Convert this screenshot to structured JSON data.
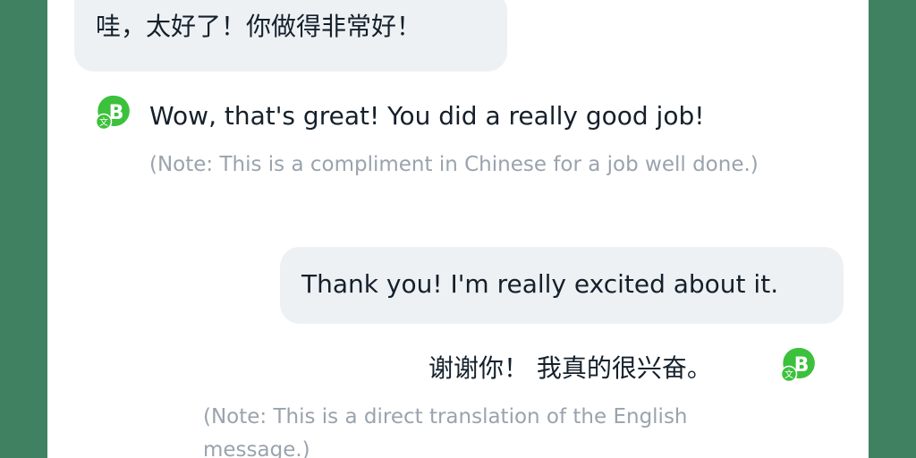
{
  "messages": [
    {
      "side": "left",
      "original": "哇，太好了！你做得非常好！",
      "translation": "Wow, that's great! You did a really good job!",
      "note": "(Note: This is a compliment in Chinese for a job well done.)"
    },
    {
      "side": "right",
      "original": "Thank you! I'm really excited about it.",
      "translation": "谢谢你！ 我真的很兴奋。",
      "note": "(Note: This is a direct translation of the English message.)"
    }
  ],
  "icons": {
    "translator": "translator-bot-icon",
    "translator_letter": "B",
    "translator_sub": "文"
  },
  "colors": {
    "background": "#3f8161",
    "panel": "#ffffff",
    "bubble": "#eef1f4",
    "text": "#14202b",
    "note": "#9aa3ad",
    "icon": "#3cc13c"
  }
}
